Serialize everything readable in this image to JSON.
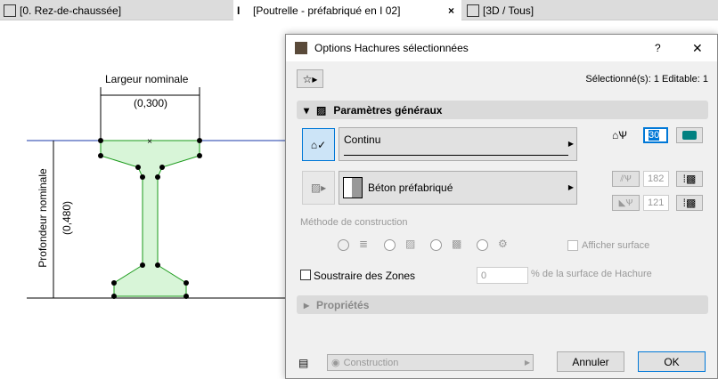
{
  "tabs": [
    {
      "label": "[0. Rez-de-chaussée]",
      "icon": "floor-plan-icon"
    },
    {
      "label": "[Poutrelle - préfabriqué en I 02]",
      "icon": "i-beam-icon",
      "active": true
    },
    {
      "label": "[3D / Tous]",
      "icon": "3d-icon"
    }
  ],
  "drawing": {
    "width_label": "Largeur nominale",
    "width_value": "(0,300)",
    "depth_label": "Profondeur nominale",
    "depth_value": "(0,480)"
  },
  "dialog": {
    "title": "Options Hachures sélectionnées",
    "help": "?",
    "close": "✕",
    "selection": "Sélectionné(s): 1 Editable: 1",
    "section_general": "Paramètres généraux",
    "line_type": "Continu",
    "pen_value": "30",
    "fill": "Béton préfabriqué",
    "fg_pen": "182",
    "bg_pen": "121",
    "method_label": "Méthode de construction",
    "show_area": "Afficher surface",
    "subtract_zones": "Soustraire des Zones",
    "area_percent_value": "0",
    "area_percent_label": "% de la surface de Hachure",
    "section_props": "Propriétés",
    "layer": "Construction",
    "cancel": "Annuler",
    "ok": "OK"
  },
  "colors": {
    "accent": "#0078d7",
    "beam_fill": "#d8f5d8",
    "beam_stroke": "#1a9a1a",
    "pen_teal": "#008080"
  }
}
